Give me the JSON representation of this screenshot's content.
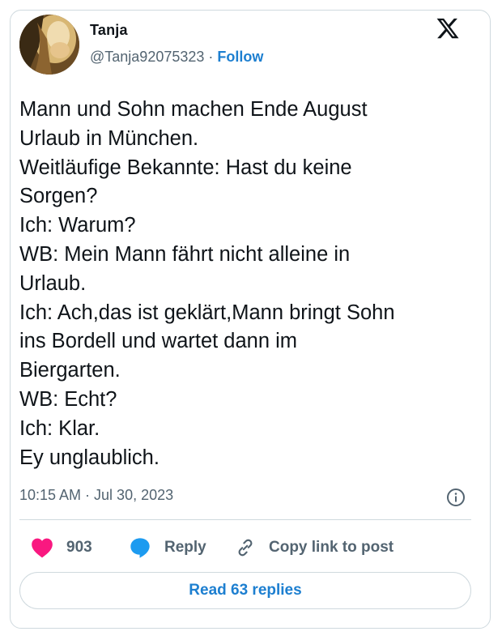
{
  "author": {
    "name": "Tanja",
    "handle": "@Tanja92075323",
    "separator": "·",
    "follow_label": "Follow"
  },
  "tweet": {
    "lines": [
      "Mann und Sohn machen Ende August",
      "Urlaub in München.",
      "Weitläufige Bekannte: Hast du keine",
      "Sorgen?",
      "Ich: Warum?",
      "WB: Mein Mann fährt nicht alleine in",
      "Urlaub.",
      "Ich: Ach,das ist geklärt,Mann bringt Sohn",
      "ins Bordell und wartet dann im",
      "Biergarten.",
      "WB: Echt?",
      "Ich: Klar.",
      "Ey unglaublich."
    ],
    "timestamp": "10:15 AM · Jul 30, 2023"
  },
  "actions": {
    "like_count": "903",
    "reply_label": "Reply",
    "copy_link_label": "Copy link to post"
  },
  "read_replies_label": "Read 63 replies",
  "colors": {
    "like": "#f91880",
    "reply": "#1d9bf0",
    "link": "#1d7fd0",
    "muted": "#536471",
    "border": "#cfd9de"
  },
  "icons": {
    "logo": "x-logo-icon",
    "info": "info-icon",
    "like": "heart-icon",
    "reply": "speech-bubble-icon",
    "copy": "link-icon"
  }
}
